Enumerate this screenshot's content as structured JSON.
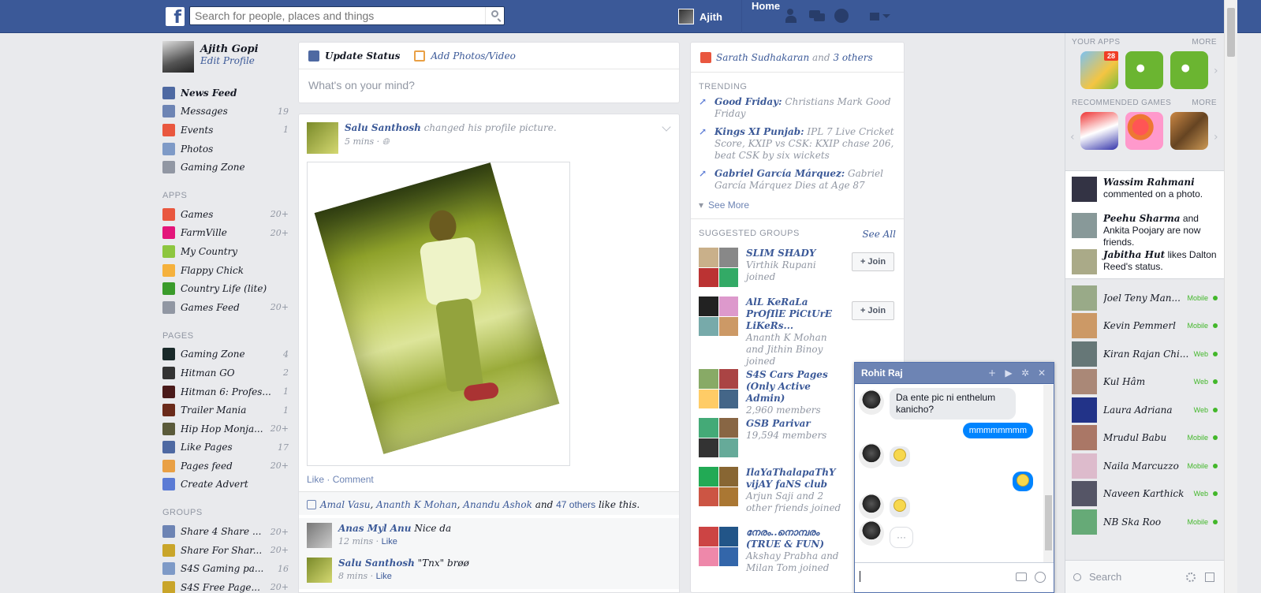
{
  "topbar": {
    "logo": "f",
    "search_placeholder": "Search for people, places and things",
    "user_name": "Ajith",
    "home_label": "Home"
  },
  "profile": {
    "name": "Ajith Gopi",
    "edit": "Edit Profile"
  },
  "nav_main": [
    {
      "label": "News Feed",
      "count": "",
      "color": "#4e69a2"
    },
    {
      "label": "Messages",
      "count": "19",
      "color": "#6d84b4"
    },
    {
      "label": "Events",
      "count": "1",
      "color": "#e9573f"
    },
    {
      "label": "Photos",
      "count": "",
      "color": "#7e9ac7"
    },
    {
      "label": "Gaming Zone",
      "count": "",
      "color": "#9197a3"
    }
  ],
  "apps_heading": "APPS",
  "nav_apps": [
    {
      "label": "Games",
      "count": "20+",
      "color": "#e9573f"
    },
    {
      "label": "FarmVille",
      "count": "20+",
      "color": "#e3157a"
    },
    {
      "label": "My Country",
      "count": "",
      "color": "#8dc63f"
    },
    {
      "label": "Flappy Chick",
      "count": "",
      "color": "#f5b13d"
    },
    {
      "label": "Country Life (lite)",
      "count": "",
      "color": "#3a9b2b"
    },
    {
      "label": "Games Feed",
      "count": "20+",
      "color": "#9197a3"
    }
  ],
  "pages_heading": "PAGES",
  "nav_pages": [
    {
      "label": "Gaming Zone",
      "count": "4",
      "color": "#1a2a2a"
    },
    {
      "label": "Hitman GO",
      "count": "2",
      "color": "#333333"
    },
    {
      "label": "Hitman 6: Profes...",
      "count": "1",
      "color": "#4a1a1a"
    },
    {
      "label": "Trailer Mania",
      "count": "1",
      "color": "#6a2a1a"
    },
    {
      "label": "Hip Hop Monja...",
      "count": "20+",
      "color": "#5a5a3a"
    },
    {
      "label": "Like Pages",
      "count": "17",
      "color": "#4e69a2"
    },
    {
      "label": "Pages feed",
      "count": "20+",
      "color": "#e9a045"
    },
    {
      "label": "Create Advert",
      "count": "",
      "color": "#5b7bd5"
    }
  ],
  "groups_heading": "GROUPS",
  "nav_groups": [
    {
      "label": "Share 4 Share ...",
      "count": "20+",
      "color": "#6d84b4"
    },
    {
      "label": "Share For Shar...",
      "count": "20+",
      "color": "#c9a52a"
    },
    {
      "label": "S4S Gaming pa...",
      "count": "16",
      "color": "#7e9ac7"
    },
    {
      "label": "S4S Free Page...",
      "count": "20+",
      "color": "#c9a52a"
    }
  ],
  "composer": {
    "update_status": "Update Status",
    "add_photos": "Add Photos/Video",
    "placeholder": "What's on your mind?"
  },
  "post": {
    "author": "Salu Santhosh",
    "action": "changed his profile picture.",
    "time": "5 mins · ",
    "like": "Like",
    "sep": "·",
    "comment": "Comment",
    "likes_names": [
      "Amal Vasu",
      "Ananth K Mohan",
      "Anandu Ashok"
    ],
    "likes_and": "and",
    "likes_others": "47 others",
    "likes_suffix": "like this.",
    "comments": [
      {
        "author": "Anas Myl Anu",
        "text": "Nice da",
        "time": "12 mins · ",
        "like": "Like"
      },
      {
        "author": "Salu Santhosh",
        "text": "\"Tnx\" brøø",
        "time": "8 mins · ",
        "like": "Like"
      }
    ]
  },
  "right": {
    "birthday_name": "Sarath Sudhakaran",
    "birthday_and": "and",
    "birthday_others": "3 others",
    "trending_heading": "TRENDING",
    "trending": [
      {
        "topic": "Good Friday:",
        "text": "Christians Mark Good Friday"
      },
      {
        "topic": "Kings XI Punjab:",
        "text": "IPL 7 Live Cricket Score, KXIP vs CSK: KXIP chase 206, beat CSK by six wickets"
      },
      {
        "topic": "Gabriel García Márquez:",
        "text": "Gabriel García Márquez Dies at Age 87"
      }
    ],
    "see_more": "See More",
    "groups_heading": "SUGGESTED GROUPS",
    "see_all": "See All",
    "join_label": "+ Join",
    "groups": [
      {
        "name": "SLIM SHADY",
        "sub": "Virthik Rupani joined",
        "join": true
      },
      {
        "name": "AlL KeRaLa PrOfIlE PiCtUrE LiKeRs...",
        "sub": "Ananth K Mohan and Jithin Binoy joined",
        "join": true
      },
      {
        "name": "S4S Cars Pages (Only Active Admin)",
        "sub": "2,960 members",
        "join": false
      },
      {
        "name": "GSB Parivar",
        "sub": "19,594 members",
        "join": false
      },
      {
        "name": "IlaYaThalapaThY vijAY faNS club",
        "sub": "Arjun Saji and 2 other friends joined",
        "join": false
      },
      {
        "name": "നേരം..നൊമ്പരം (TRUE & FUN)",
        "sub": "Akshay Prabha and Milan Tom joined",
        "join": false
      }
    ]
  },
  "sidebar": {
    "your_apps": "YOUR APPS",
    "more": "MORE",
    "app_badge": "28",
    "recommended": "RECOMMENDED GAMES",
    "ticker": [
      {
        "name": "Wassim Rahmani",
        "text": "commented on a photo."
      },
      {
        "name": "Peehu Sharma",
        "text": "and Ankita Poojary are now friends."
      },
      {
        "name": "Jabitha Hut",
        "text": "likes Dalton Reed's status."
      }
    ],
    "friends": [
      {
        "name": "Joel Teny Man...",
        "status": "Mobile"
      },
      {
        "name": "Kevin Pemmerl",
        "status": "Mobile"
      },
      {
        "name": "Kiran Rajan Chi...",
        "status": "Web"
      },
      {
        "name": "Kul Hâm",
        "status": "Web"
      },
      {
        "name": "Laura Adriana",
        "status": "Web"
      },
      {
        "name": "Mrudul Babu",
        "status": "Mobile"
      },
      {
        "name": "Naila Marcuzzo",
        "status": "Mobile"
      },
      {
        "name": "Naveen Karthick",
        "status": "Web"
      },
      {
        "name": "NB Ska Roo",
        "status": "Mobile"
      }
    ],
    "search_placeholder": "Search"
  },
  "chat": {
    "name": "Rohit Raj",
    "msg1": "Da ente pic ni enthelum kanicho?",
    "msg2": "mmmmmmmm",
    "typing": "···"
  }
}
